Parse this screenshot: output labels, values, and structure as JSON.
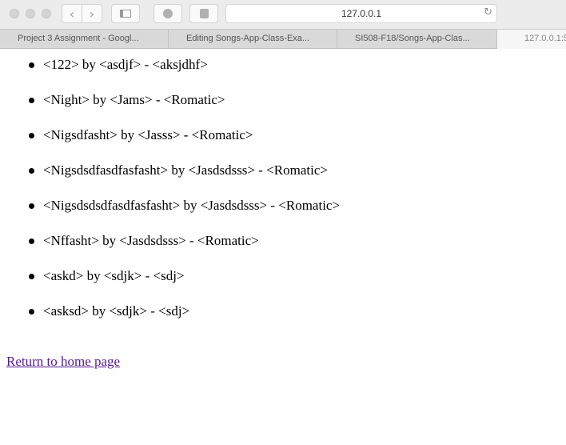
{
  "browser": {
    "address": "127.0.0.1",
    "tabs": [
      "Project 3 Assignment - Googl...",
      "Editing Songs-App-Class-Exa...",
      "SI508-F18/Songs-App-Clas...",
      "127.0.0.1:5"
    ]
  },
  "songs": [
    "<122> by <asdjf> - <aksjdhf>",
    "<Night> by <Jams> - <Romatic>",
    "<Nigsdfasht> by <Jasss> - <Romatic>",
    "<Nigsdsdfasdfasfasht> by <Jasdsdsss> - <Romatic>",
    "<Nigsdsdsdfasdfasfasht> by <Jasdsdsss> - <Romatic>",
    "<Nffasht> by <Jasdsdsss> - <Romatic>",
    "<askd> by <sdjk> - <sdj>",
    "<asksd> by <sdjk> - <sdj>"
  ],
  "return_link": "Return to home page"
}
